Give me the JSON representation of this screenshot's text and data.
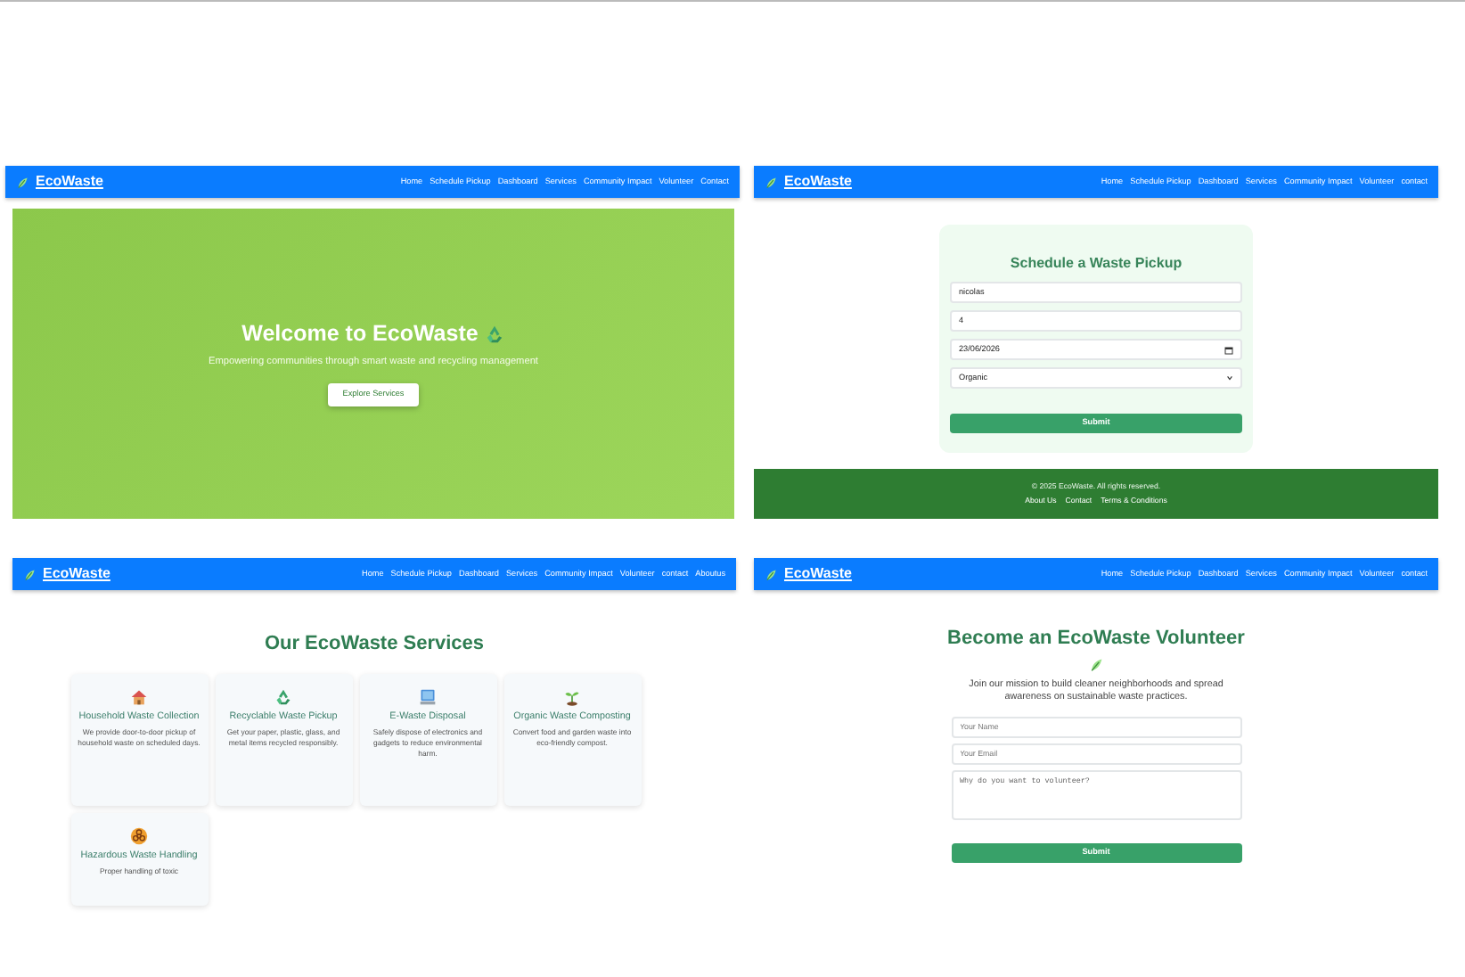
{
  "panels": [
    {
      "kind": "home",
      "navbar": {
        "brand": "EcoWaste",
        "links": [
          "Home",
          "Schedule Pickup",
          "Dashboard",
          "Services",
          "Community Impact",
          "Volunteer",
          "Contact"
        ]
      },
      "hero": {
        "title": "Welcome to EcoWaste",
        "subtitle": "Empowering communities through smart waste and recycling management",
        "button": "Explore Services"
      }
    },
    {
      "kind": "pickup",
      "navbar": {
        "brand": "EcoWaste",
        "links": [
          "Home",
          "Schedule Pickup",
          "Dashboard",
          "Services",
          "Community Impact",
          "Volunteer",
          "contact"
        ]
      },
      "form": {
        "title": "Schedule a Waste Pickup",
        "fields": [
          {
            "kind": "text",
            "value": "nicolas"
          },
          {
            "kind": "text",
            "value": "4"
          },
          {
            "kind": "date",
            "value": "23/06/2026"
          },
          {
            "kind": "select",
            "value": "Organic"
          }
        ],
        "button": "Submit"
      },
      "footer": {
        "copyright": "© 2025 EcoWaste. All rights reserved.",
        "links": [
          "About Us",
          "Contact",
          "Terms & Conditions"
        ]
      }
    },
    {
      "kind": "services",
      "navbar": {
        "brand": "EcoWaste",
        "links": [
          "Home",
          "Schedule Pickup",
          "Dashboard",
          "Services",
          "Community Impact",
          "Volunteer",
          "contact",
          "Aboutus"
        ]
      },
      "title": "Our EcoWaste Services",
      "cards": [
        {
          "kind": "house",
          "title": "Household Waste Collection",
          "text": "We provide door-to-door pickup of household waste on scheduled days."
        },
        {
          "kind": "recycle",
          "title": "Recyclable Waste Pickup",
          "text": "Get your paper, plastic, glass, and metal items recycled responsibly."
        },
        {
          "kind": "computer",
          "title": "E-Waste Disposal",
          "text": "Safely dispose of electronics and gadgets to reduce environmental harm."
        },
        {
          "kind": "sprout",
          "title": "Organic Waste Composting",
          "text": "Convert food and garden waste into eco-friendly compost."
        },
        {
          "kind": "biohazard",
          "title": "Hazardous Waste Handling",
          "text": "Proper handling of toxic"
        }
      ]
    },
    {
      "kind": "volunteer",
      "navbar": {
        "brand": "EcoWaste",
        "links": [
          "Home",
          "Schedule Pickup",
          "Dashboard",
          "Services",
          "Community Impact",
          "Volunteer",
          "contact"
        ]
      },
      "title": "Become an EcoWaste Volunteer",
      "text": "Join our mission to build cleaner neighborhoods and spread awareness on sustainable waste practices.",
      "form": {
        "fields": [
          {
            "kind": "input",
            "placeholder": "Your Name"
          },
          {
            "kind": "input",
            "placeholder": "Your Email"
          },
          {
            "kind": "textarea",
            "placeholder": "Why do you want to volunteer?"
          }
        ],
        "button": "Submit"
      }
    }
  ]
}
